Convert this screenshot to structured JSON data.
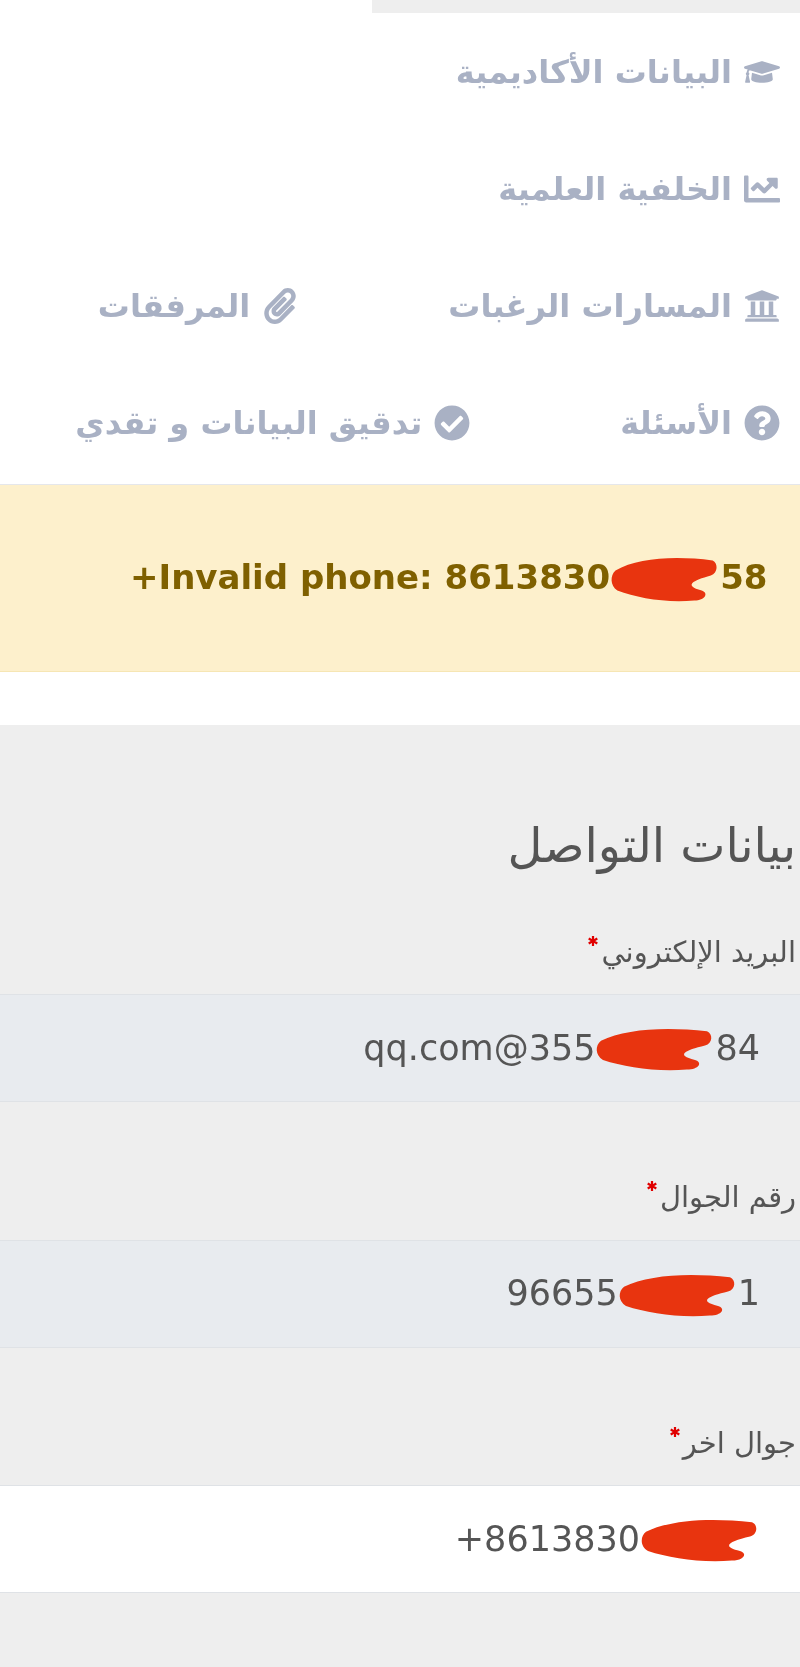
{
  "nav_rows": [
    [
      {
        "label": "البيانات الأكاديمية"
      }
    ],
    [
      {
        "label": "الخلفية العلمية"
      }
    ],
    [
      {
        "label": "المسارات الرغبات"
      },
      {
        "label": "المرفقات"
      }
    ],
    [
      {
        "label": "الأسئلة"
      },
      {
        "label": "تدقيق البيانات و تقدي"
      }
    ]
  ],
  "alert": {
    "text": "+Invalid phone: 8613830",
    "text_after": "58",
    "redacted": true
  },
  "section": {
    "title": "بيانات التواصل",
    "fields": [
      {
        "label": "البريد الإلكتروني",
        "required": true,
        "value": "qq.com@355",
        "value_after": "84",
        "redacted": true,
        "disabled": true
      },
      {
        "label": "رقم الجوال",
        "required": true,
        "value": "96655",
        "value_after": "1",
        "redacted": true,
        "disabled": true
      },
      {
        "label": "جوال اخر",
        "required": true,
        "value": "+8613830",
        "redacted": true,
        "disabled": false
      }
    ]
  }
}
